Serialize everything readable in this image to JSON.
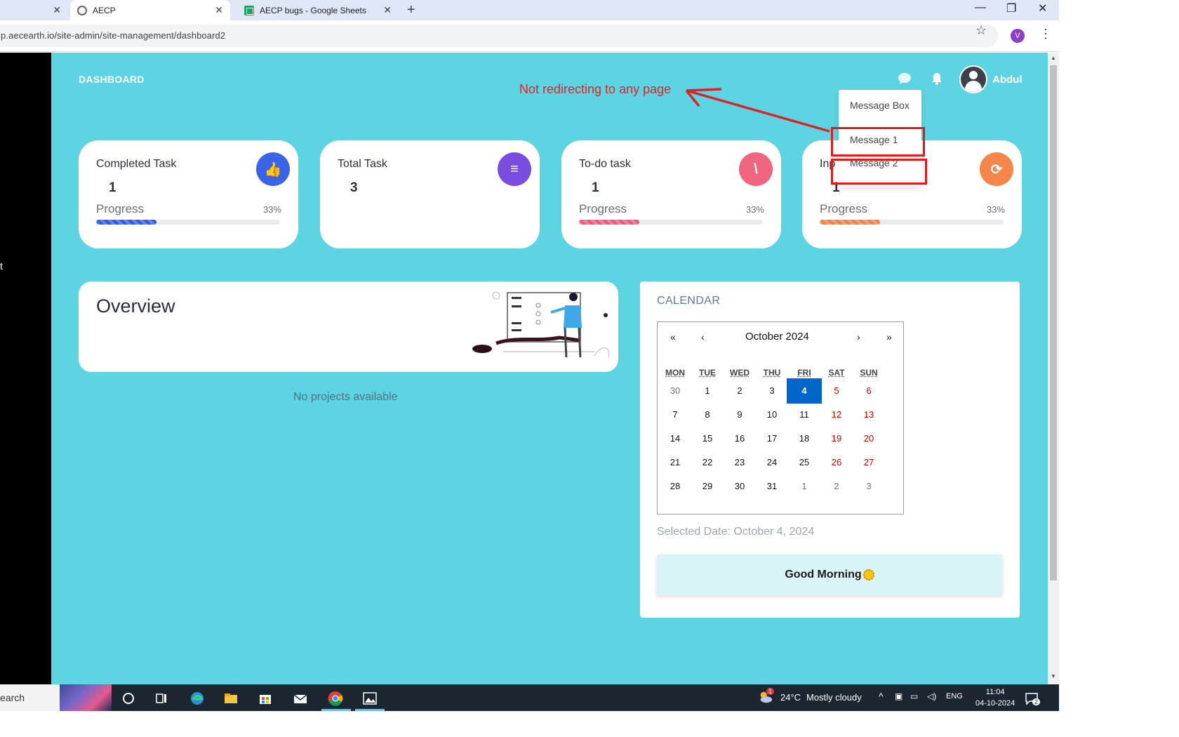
{
  "browser": {
    "tabs": [
      {
        "title": "",
        "close": "✕"
      },
      {
        "title": "AECP",
        "close": "✕"
      },
      {
        "title": "AECP bugs - Google Sheets",
        "close": "✕"
      }
    ],
    "new_tab": "+",
    "window_controls": {
      "minimize": "—",
      "restore": "❐",
      "close": "✕"
    },
    "url": "p.aecearth.io/site-admin/site-management/dashboard2",
    "bookmark_icon": "☆",
    "profile_initial": "V",
    "menu_icon": "⋮"
  },
  "sidebar": {
    "partial_text": "t"
  },
  "header": {
    "title": "DASHBOARD",
    "user_name": "Abdul"
  },
  "cards": [
    {
      "title": "Completed Task",
      "value": "1",
      "icon_color": "#3a63e8",
      "icon_glyph": "👍",
      "has_progress": true,
      "progress_label": "Progress",
      "progress_pct": "33%",
      "progress": 0.33,
      "bar_color": "#2f5bea"
    },
    {
      "title": "Total Task",
      "value": "3",
      "icon_color": "#7a4de0",
      "icon_glyph": "≡",
      "has_progress": false
    },
    {
      "title": "To-do task",
      "value": "1",
      "icon_color": "#f0667f",
      "icon_glyph": "\\",
      "has_progress": true,
      "progress_label": "Progress",
      "progress_pct": "33%",
      "progress": 0.33,
      "bar_color": "#f0577a"
    },
    {
      "title": "Inp",
      "value": "1",
      "icon_color": "#f5864a",
      "icon_glyph": "⟳",
      "has_progress": true,
      "progress_label": "Progress",
      "progress_pct": "33%",
      "progress": 0.33,
      "bar_color": "#f57f45"
    }
  ],
  "overview": {
    "title": "Overview",
    "empty_text": "No projects available"
  },
  "calendar": {
    "label": "CALENDAR",
    "month": "October 2024",
    "nav": {
      "prev_year": "«",
      "prev_month": "‹",
      "next_month": "›",
      "next_year": "»"
    },
    "weekdays": [
      "MON",
      "TUE",
      "WED",
      "THU",
      "FRI",
      "SAT",
      "SUN"
    ],
    "weeks": [
      [
        "30",
        "1",
        "2",
        "3",
        "4",
        "5",
        "6"
      ],
      [
        "7",
        "8",
        "9",
        "10",
        "11",
        "12",
        "13"
      ],
      [
        "14",
        "15",
        "16",
        "17",
        "18",
        "19",
        "20"
      ],
      [
        "21",
        "22",
        "23",
        "24",
        "25",
        "26",
        "27"
      ],
      [
        "28",
        "29",
        "30",
        "31",
        "1",
        "2",
        "3"
      ]
    ],
    "selected_day": "4",
    "selected_text": "Selected Date: October 4, 2024",
    "greeting": "Good Morning"
  },
  "message_dropdown": {
    "items": [
      "Message Box",
      "Message 1",
      "Message 2"
    ]
  },
  "annotation": {
    "text": "Not redirecting to any page",
    "color": "#d9252a"
  },
  "taskbar": {
    "search_text": "earch",
    "weather_temp": "24°C",
    "weather_desc": "Mostly cloudy",
    "weather_badge": "1",
    "language": "ENG",
    "time": "11:04",
    "date": "04-10-2024",
    "notification_count": "2"
  }
}
